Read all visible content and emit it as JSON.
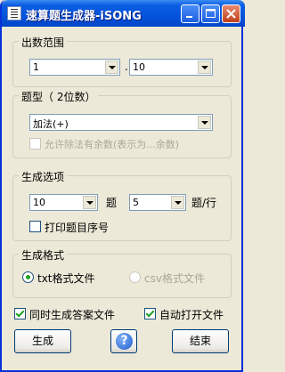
{
  "window": {
    "title": "速算题生成器-iSONG"
  },
  "range": {
    "label": "出数范围",
    "from": "1",
    "separator": ".",
    "to": "10"
  },
  "type": {
    "label": "题型（ 2位数）",
    "selected": "加法(+)",
    "allow_remainder_label": "允许除法有余数(表示为...余数)"
  },
  "options": {
    "label": "生成选项",
    "count": "10",
    "count_unit": "题",
    "per_row": "5",
    "per_row_unit": "题/行",
    "print_number_label": "打印题目序号"
  },
  "format": {
    "label": "生成格式",
    "txt_label": "txt格式文件",
    "csv_label": "csv格式文件"
  },
  "checks": {
    "answer_file_label": "同时生成答案文件",
    "auto_open_label": "自动打开文件"
  },
  "buttons": {
    "generate": "生成",
    "help": "?",
    "end": "结束"
  }
}
